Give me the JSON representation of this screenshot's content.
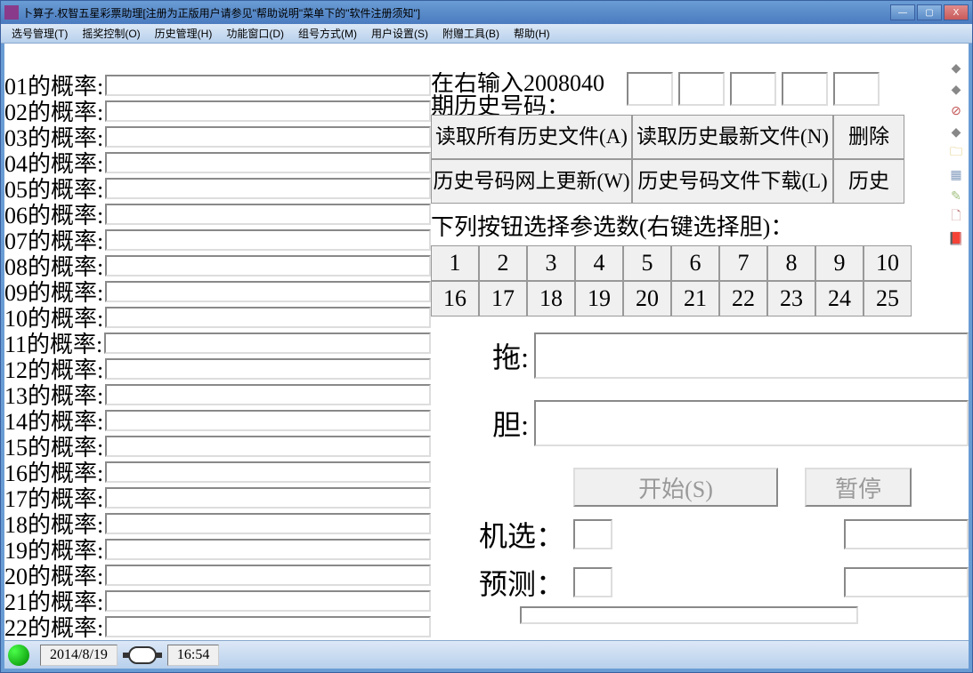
{
  "titlebar": {
    "title": "卜算子.权智五星彩票助理[注册为正版用户请参见\"帮助说明\"菜单下的\"软件注册须知\"]"
  },
  "menu": {
    "items": [
      "选号管理(T)",
      "摇奖控制(O)",
      "历史管理(H)",
      "功能窗口(D)",
      "组号方式(M)",
      "用户设置(S)",
      "附赠工具(B)",
      "帮助(H)"
    ]
  },
  "prob_labels": [
    "01的概率:",
    "02的概率:",
    "03的概率:",
    "04的概率:",
    "05的概率:",
    "06的概率:",
    "07的概率:",
    "08的概率:",
    "09的概率:",
    "10的概率:",
    "11的概率:",
    "12的概率:",
    "13的概率:",
    "14的概率:",
    "15的概率:",
    "16的概率:",
    "17的概率:",
    "18的概率:",
    "19的概率:",
    "20的概率:",
    "21的概率:",
    "22的概率:"
  ],
  "right": {
    "input_label_line1": "在右输入2008040",
    "input_label_line2": "期历史号码：",
    "buttons": {
      "read_all": "读取所有历史文件(A)",
      "read_new": "读取历史最新文件(N)",
      "delete": "删除",
      "web_update": "历史号码网上更新(W)",
      "file_download": "历史号码文件下载(L)",
      "history": "历史"
    },
    "pick_header": "下列按钮选择参选数(右键选择胆)：",
    "numbers_row1": [
      "1",
      "2",
      "3",
      "4",
      "5",
      "6",
      "7",
      "8",
      "9",
      "10"
    ],
    "numbers_row2": [
      "16",
      "17",
      "18",
      "19",
      "20",
      "21",
      "22",
      "23",
      "24",
      "25"
    ],
    "drag_label": "拖:",
    "dan_label": "胆:",
    "start_label": "开始(S)",
    "pause_label": "暂停",
    "jixuan_label": "机选：",
    "yuce_label": "预测："
  },
  "statusbar": {
    "date": "2014/8/19",
    "time": "16:54"
  },
  "toolbar_icons": [
    "◆",
    "◆",
    "⊘",
    "◆",
    "🗀",
    "▦",
    "✎",
    "🗋",
    "📕"
  ]
}
